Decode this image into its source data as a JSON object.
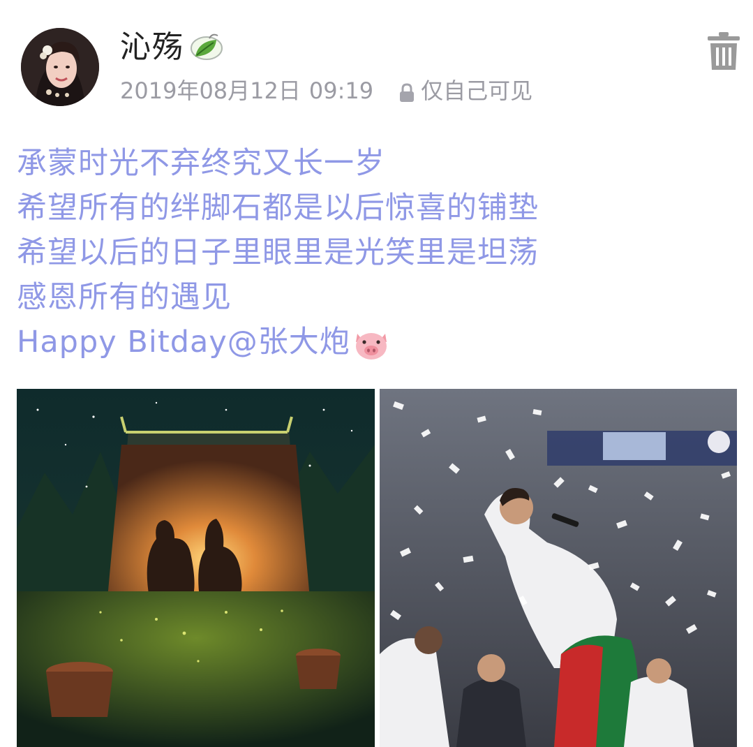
{
  "post": {
    "author": {
      "name": "沁殇",
      "name_badge_icon": "leaf-icon",
      "avatar": "avatar"
    },
    "date": "2019年08月12日",
    "time": "09:19",
    "privacy_icon": "lock-icon",
    "privacy": "仅自己可见",
    "delete_icon": "trash-icon",
    "lines": [
      "承蒙时光不弃终究又长一岁",
      "希望所有的绊脚石都是以后惊喜的铺垫",
      "希望以后的日子里眼里是光笑里是坦荡",
      "感恩所有的遇见",
      "Happy Bitday@张大炮"
    ],
    "emoji_icon": "pig-face-icon",
    "images": [
      {
        "name": "bunny-silhouette-illustration"
      },
      {
        "name": "celebration-confetti-photo"
      }
    ]
  },
  "colors": {
    "text_accent": "#8f98e6",
    "meta_text": "#9b9ba3",
    "username": "#222222",
    "trash_icon": "#9a9a9a"
  }
}
